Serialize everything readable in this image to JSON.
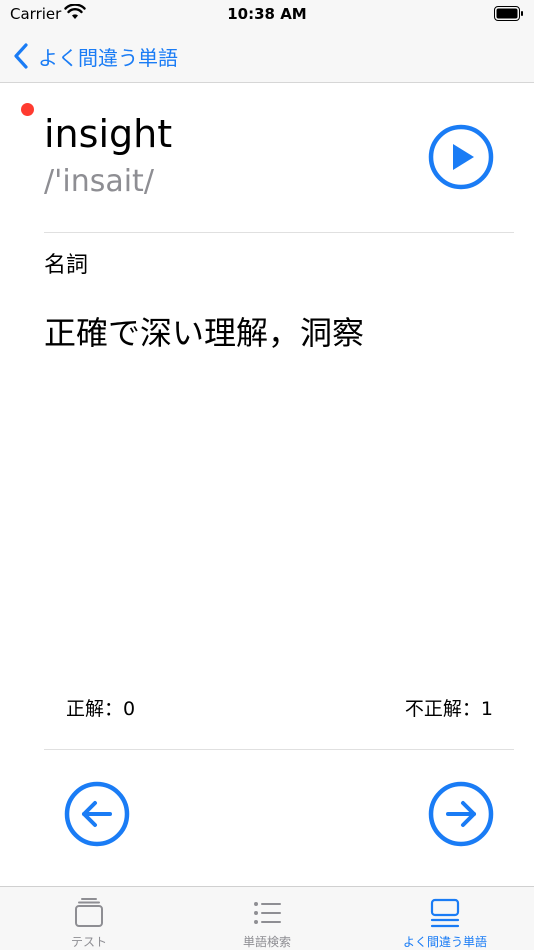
{
  "status_bar": {
    "carrier": "Carrier",
    "time": "10:38 AM"
  },
  "nav": {
    "back_label": "よく間違う単語"
  },
  "card": {
    "word": "insight",
    "phonetic": "/'insait/",
    "part_of_speech": "名詞",
    "meaning": "正確で深い理解，洞察"
  },
  "stats": {
    "correct_label": "正解：",
    "correct_count": "0",
    "incorrect_label": "不正解：",
    "incorrect_count": "1"
  },
  "tabs": [
    {
      "label": "テスト",
      "icon": "cards-icon",
      "active": false
    },
    {
      "label": "単語検索",
      "icon": "list-icon",
      "active": false
    },
    {
      "label": "よく間違う単語",
      "icon": "mistakes-list-icon",
      "active": true
    }
  ],
  "colors": {
    "accent": "#1a7cf5",
    "mistake_dot": "#ff3b30",
    "secondary_text": "#8e8e93"
  }
}
